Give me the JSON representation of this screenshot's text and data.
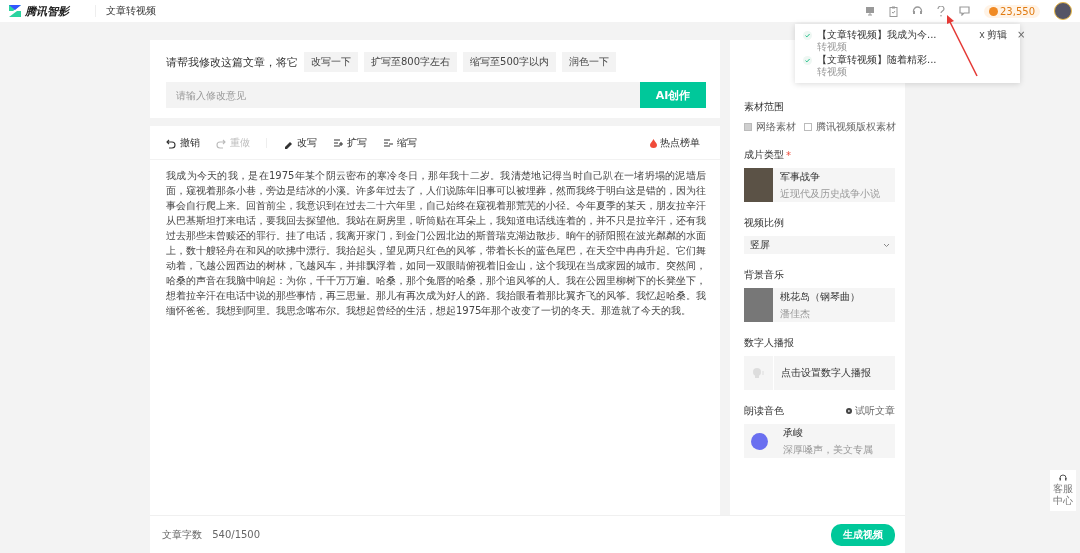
{
  "header": {
    "logo": "腾讯智影",
    "page_title": "文章转视频",
    "coins": "23,550"
  },
  "notifications": [
    {
      "title": "【文章转视频】我成为今...",
      "subtitle": "转视频",
      "action": "剪辑",
      "close": "×"
    },
    {
      "title": "【文章转视频】随着精彩...",
      "subtitle": "转视频"
    }
  ],
  "prompt": {
    "label": "请帮我修改这篇文章，将它",
    "chips": [
      "改写一下",
      "扩写至800字左右",
      "缩写至500字以内",
      "润色一下"
    ],
    "placeholder": "请输入修改意见",
    "submit": "AI创作"
  },
  "toolbar": {
    "items": [
      {
        "kind": "undo",
        "label": "撤销",
        "disabled": false
      },
      {
        "kind": "redo",
        "label": "重做",
        "disabled": true
      },
      {
        "kind": "rewrite",
        "label": "改写",
        "disabled": false
      },
      {
        "kind": "expand",
        "label": "扩写",
        "disabled": false
      },
      {
        "kind": "shrink",
        "label": "缩写",
        "disabled": false
      }
    ],
    "hot": "热点榜单"
  },
  "article": "我成为今天的我，是在1975年某个阴云密布的寒冷冬日，那年我十二岁。我清楚地记得当时自己趴在一堵坍塌的泥墙后面，窥视着那条小巷，旁边是结冰的小溪。许多年过去了，人们说陈年旧事可以被埋葬，然而我终于明白这是错的，因为往事会自行爬上来。回首前尘，我意识到在过去二十六年里，自己始终在窥视着那荒芜的小径。今年夏季的某天，朋友拉辛汗从巴基斯坦打来电话，要我回去探望他。我站在厨房里，听筒贴在耳朵上，我知道电话线连着的，并不只是拉辛汗，还有我过去那些未曾赎还的罪行。挂了电话，我离开家门，到金门公园北边的斯普瑞克湖边散步。晌午的骄阳照在波光粼粼的水面上，数十艘轻舟在和风的吹拂中漂行。我抬起头，望见两只红色的风筝，带着长长的蓝色尾巴，在天空中冉冉升起。它们舞动着，飞越公园西边的树林，飞越风车，并排飘浮着，如同一双眼睛俯视着旧金山，这个我现在当成家园的城市。突然间，哈桑的声音在我脑中响起：为你，千千万万遍。哈桑，那个兔唇的哈桑，那个追风筝的人。我在公园里柳树下的长凳坐下，想着拉辛汗在电话中说的那些事情，再三思量。那儿有再次成为好人的路。我抬眼看着那比翼齐飞的风筝。我忆起哈桑。我缅怀爸爸。我想到阿里。我思念喀布尔。我想起曾经的生活，想起1975年那个改变了一切的冬天。那造就了今天的我。",
  "footer": {
    "word_count_label": "文章字数",
    "word_count": "540/1500",
    "generate": "生成视频"
  },
  "side": {
    "material_scope": {
      "title": "素材范围",
      "options": [
        {
          "label": "网络素材",
          "checked": true
        },
        {
          "label": "腾讯视频版权素材",
          "checked": false
        }
      ]
    },
    "film_type": {
      "title": "成片类型",
      "required_mark": "*",
      "name": "军事战争",
      "desc": "近现代及历史战争小说"
    },
    "ratio": {
      "title": "视频比例",
      "value": "竖屏"
    },
    "music": {
      "title": "背景音乐",
      "name": "桃花岛（钢琴曲）",
      "artist": "潘佳杰"
    },
    "avatar": {
      "title": "数字人播报",
      "action": "点击设置数字人播报"
    },
    "voice": {
      "title": "朗读音色",
      "preview": "试听文章",
      "name": "承峻",
      "desc": "深厚嗓声，美文专属"
    }
  },
  "help": {
    "label": "客服中心"
  }
}
